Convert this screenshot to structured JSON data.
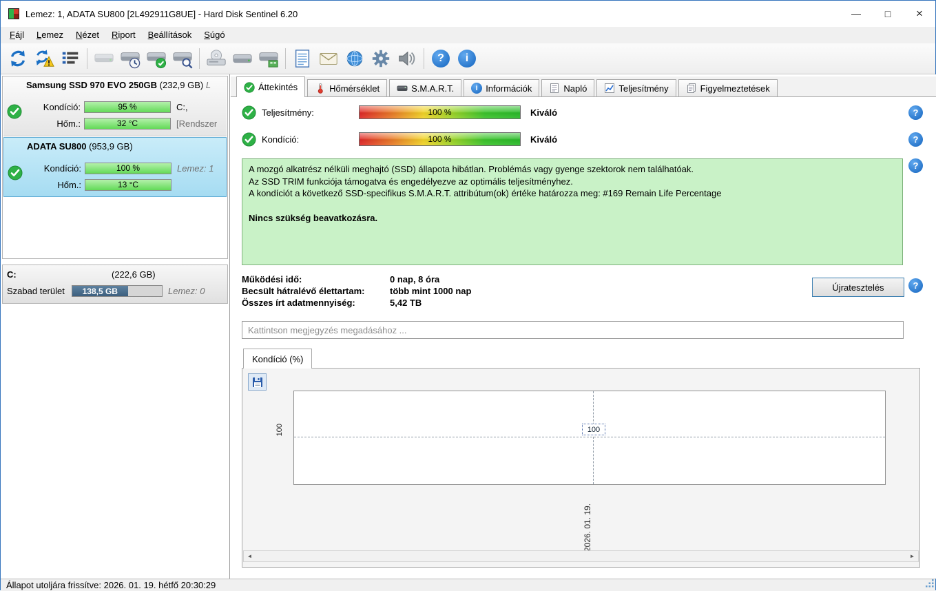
{
  "window": {
    "title": "Lemez: 1, ADATA SU800 [2L492911G8UE]  -  Hard Disk Sentinel 6.20"
  },
  "glyphs": {
    "minimize": "—",
    "maximize": "□",
    "close": "×",
    "help": "?",
    "info": "i",
    "scroll_left": "◄",
    "scroll_right": "►"
  },
  "menu": {
    "items": [
      "Fájl",
      "Lemez",
      "Nézet",
      "Riport",
      "Beállítások",
      "Súgó"
    ]
  },
  "toolbar": {
    "buttons": [
      "refresh",
      "refresh-warning",
      "report",
      "disk",
      "disk-clock",
      "disk-check",
      "disk-search",
      "cdrom",
      "disk-copy",
      "disk-card",
      "notes",
      "mail",
      "globe-disk",
      "gear",
      "speaker",
      "help",
      "info"
    ]
  },
  "sidebar": {
    "disks": [
      {
        "name": "Samsung SSD 970 EVO 250GB",
        "size": "(232,9 GB)",
        "trail": "L",
        "cond_label": "Kondíció:",
        "cond_value": "95 %",
        "temp_label": "Hőm.:",
        "temp_value": "32 °C",
        "drive": "C:,",
        "note": "[Rendszer"
      },
      {
        "name": "ADATA SU800",
        "size": "(953,9 GB)",
        "cond_label": "Kondíció:",
        "cond_value": "100 %",
        "temp_label": "Hőm.:",
        "temp_value": "13 °C",
        "drive": "Lemez: 1"
      }
    ],
    "partition": {
      "name": "C:",
      "size": "(222,6 GB)",
      "free_label": "Szabad terület",
      "free_value": "138,5 GB",
      "drive": "Lemez: 0"
    }
  },
  "tabs": {
    "items": [
      {
        "label": "Áttekintés"
      },
      {
        "label": "Hőmérséklet"
      },
      {
        "label": "S.M.A.R.T."
      },
      {
        "label": "Információk"
      },
      {
        "label": "Napló"
      },
      {
        "label": "Teljesítmény"
      },
      {
        "label": "Figyelmeztetések"
      }
    ]
  },
  "overview": {
    "performance_label": "Teljesítmény:",
    "performance_value": "100 %",
    "performance_rating": "Kiváló",
    "condition_label": "Kondíció:",
    "condition_value": "100 %",
    "condition_rating": "Kiváló",
    "info_lines": [
      "A mozgó alkatrész nélküli meghajtó (SSD) állapota hibátlan. Problémás vagy gyenge szektorok nem találhatóak.",
      "Az SSD TRIM funkciója támogatva és engedélyezve az optimális teljesítményhez.",
      "A kondíciót a következő SSD-specifikus S.M.A.R.T. attribútum(ok) értéke határozza meg:  #169 Remain Life Percentage"
    ],
    "info_bold": "Nincs szükség beavatkozásra.",
    "stats": [
      {
        "label": "Működési idő:",
        "value": "0 nap, 8 óra"
      },
      {
        "label": "Becsült hátralévő élettartam:",
        "value": "több mint 1000 nap"
      },
      {
        "label": "Összes írt adatmennyiség:",
        "value": "5,42 TB"
      }
    ],
    "retest_button": "Újratesztelés",
    "comment_placeholder": "Kattintson megjegyzés megadásához ...",
    "chart_tab": "Kondíció  (%)"
  },
  "chart_data": {
    "type": "line",
    "title": "Kondíció (%)",
    "x": [
      "2026. 01. 19."
    ],
    "series": [
      {
        "name": "Kondíció",
        "values": [
          100
        ]
      }
    ],
    "yticks": [
      "100"
    ],
    "point_label": "100",
    "grid": "dashed crosshair at current data point",
    "legend": "none"
  },
  "statusbar": {
    "text": "Állapot utoljára frissítve: 2026. 01. 19. hétfő 20:30:29"
  }
}
